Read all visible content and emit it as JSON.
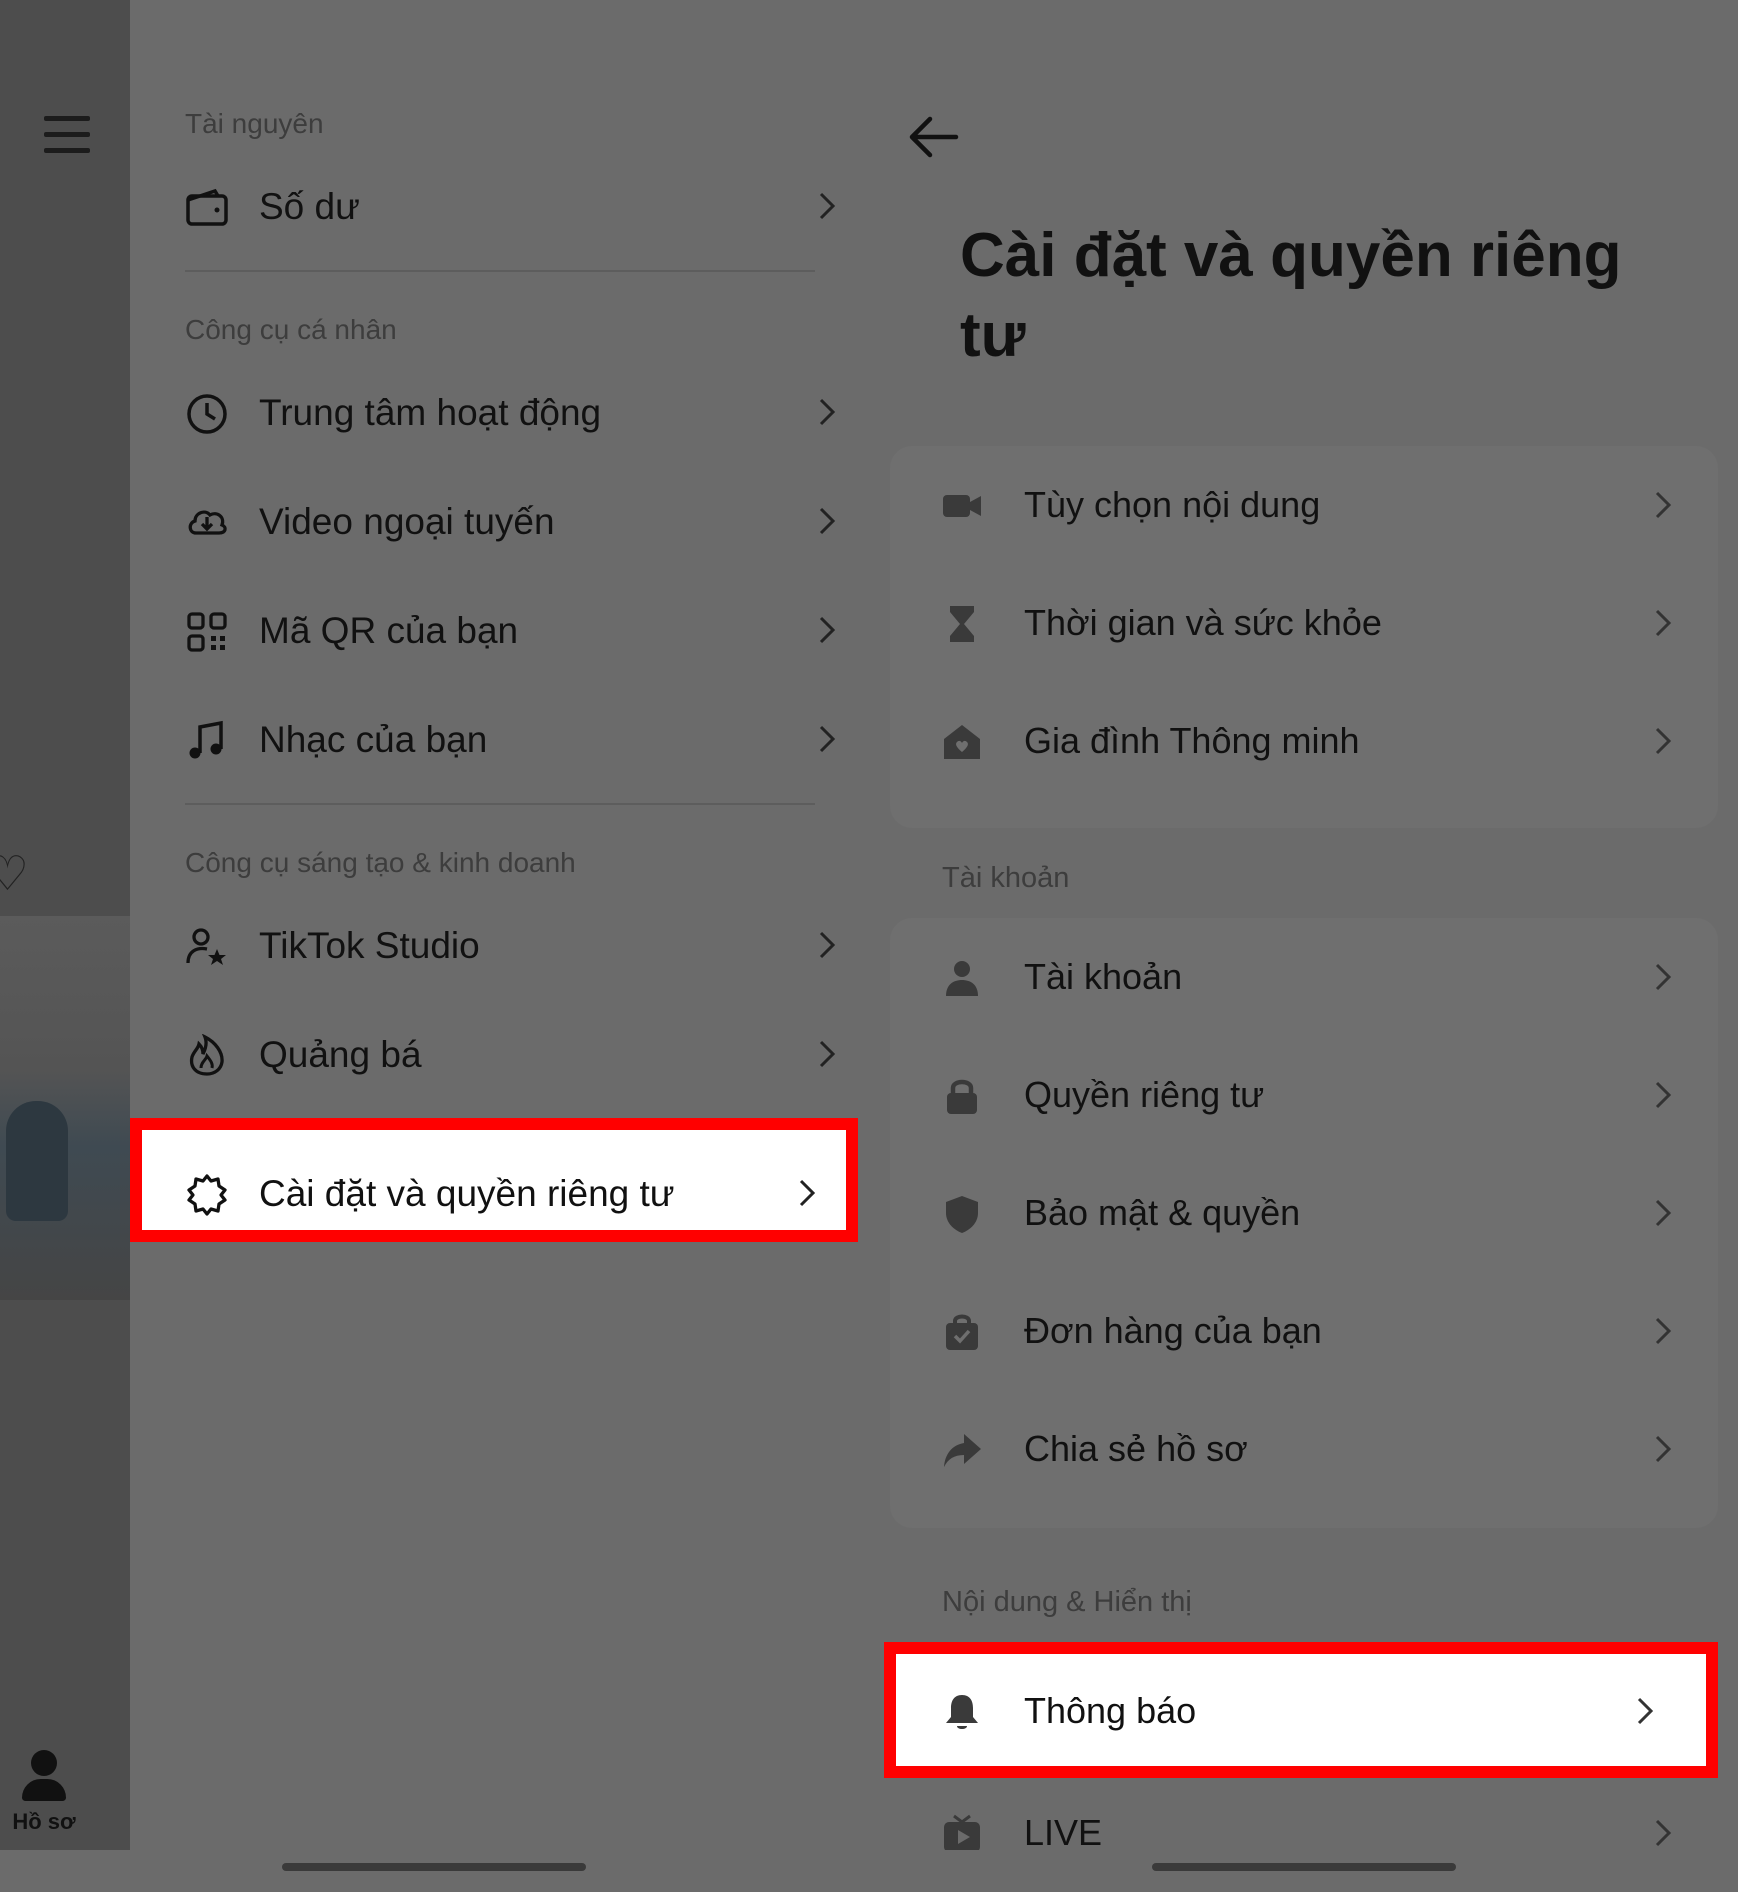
{
  "left_strip": {
    "profile_label": "Hồ sơ"
  },
  "menu": {
    "sections": [
      {
        "header": "Tài nguyên",
        "items": [
          {
            "label": "Số dư",
            "icon": "wallet-icon"
          }
        ]
      },
      {
        "header": "Công cụ cá nhân",
        "items": [
          {
            "label": "Trung tâm hoạt động",
            "icon": "clock-icon"
          },
          {
            "label": "Video ngoại tuyến",
            "icon": "cloud-download-icon"
          },
          {
            "label": "Mã QR của bạn",
            "icon": "qr-code-icon"
          },
          {
            "label": "Nhạc của bạn",
            "icon": "music-note-icon"
          }
        ]
      },
      {
        "header": "Công cụ sáng tạo & kinh doanh",
        "items": [
          {
            "label": "TikTok Studio",
            "icon": "user-star-icon"
          },
          {
            "label": "Quảng bá",
            "icon": "flame-icon"
          }
        ]
      }
    ],
    "highlighted_item": {
      "label": "Cài đặt và quyền riêng tư",
      "icon": "gear-icon"
    }
  },
  "settings": {
    "title": "Cài đặt và quyền riêng tư",
    "group1": [
      {
        "label": "Tùy chọn nội dung",
        "icon": "video-camera-icon"
      },
      {
        "label": "Thời gian và sức khỏe",
        "icon": "hourglass-icon"
      },
      {
        "label": "Gia đình Thông minh",
        "icon": "home-heart-icon"
      }
    ],
    "account_header": "Tài khoản",
    "group2": [
      {
        "label": "Tài khoản",
        "icon": "person-icon"
      },
      {
        "label": "Quyền riêng tư",
        "icon": "lock-icon"
      },
      {
        "label": "Bảo mật & quyền",
        "icon": "shield-icon"
      },
      {
        "label": "Đơn hàng của bạn",
        "icon": "shopping-bag-icon"
      },
      {
        "label": "Chia sẻ hồ sơ",
        "icon": "share-arrow-icon"
      }
    ],
    "content_header": "Nội dung & Hiển thị",
    "highlighted_item": {
      "label": "Thông báo",
      "icon": "bell-icon"
    },
    "last_item": {
      "label": "LIVE",
      "icon": "tv-icon"
    }
  },
  "colors": {
    "highlight_border": "#ff0000",
    "overlay": "#6b6b6b",
    "text": "#111111"
  }
}
